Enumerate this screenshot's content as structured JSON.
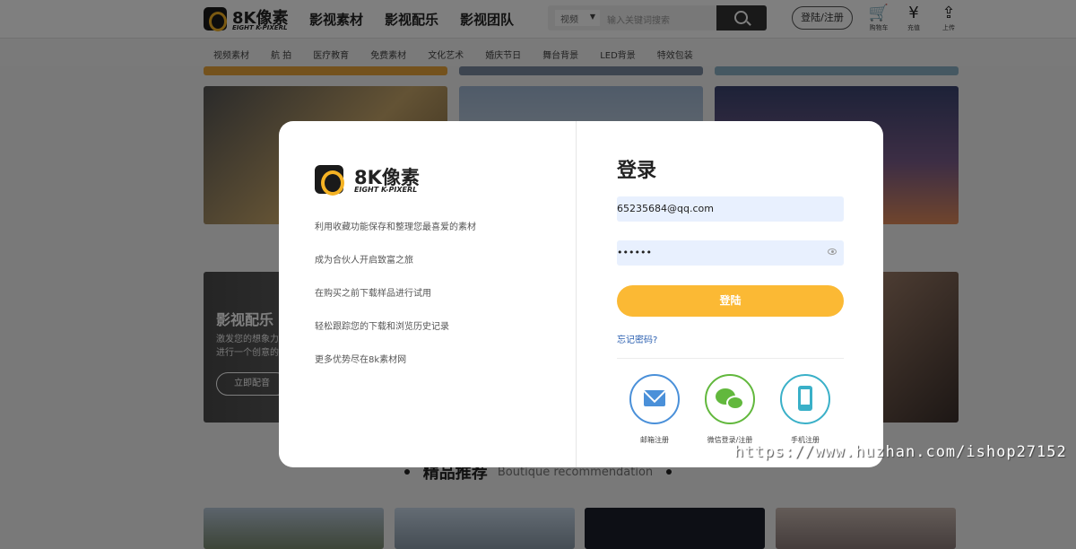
{
  "header": {
    "logo_title": "8K像素",
    "logo_sub": "EIGHT K-PIXERL",
    "nav": [
      "影视素材",
      "影视配乐",
      "影视团队"
    ],
    "search_select": "视频",
    "search_placeholder": "输入关键词搜索",
    "login_label": "登陆/注册",
    "icons": [
      {
        "name": "cart-icon",
        "glyph": "🛒",
        "label": "购物车"
      },
      {
        "name": "yen-icon",
        "glyph": "¥",
        "label": "充值"
      },
      {
        "name": "upload-icon",
        "glyph": "⇪",
        "label": "上传"
      }
    ]
  },
  "subnav": [
    "视频素材",
    "航 拍",
    "医疗教育",
    "免费素材",
    "文化艺术",
    "婚庆节日",
    "舞台背景",
    "LED背景",
    "特效包装"
  ],
  "banner": {
    "title": "影视配乐",
    "subtitle_1": "激发您的想象力",
    "subtitle_2": "进行一个创意的",
    "button": "立即配音"
  },
  "recommend": {
    "title": "精品推荐",
    "subtitle": "Boutique recommendation"
  },
  "modal": {
    "logo_title": "8K像素",
    "logo_sub": "EIGHT K-PIXERL",
    "features": [
      "利用收藏功能保存和整理您最喜爱的素材",
      "成为合伙人开启致富之旅",
      "在购买之前下载样品进行试用",
      "轻松跟踪您的下载和浏览历史记录",
      "更多优势尽在8k素材网"
    ],
    "title": "登录",
    "email_value": "65235684@qq.com",
    "password_value": "••••••",
    "submit_label": "登陆",
    "forgot_label": "忘记密码?",
    "social": [
      {
        "name": "email-register",
        "label": "邮箱注册"
      },
      {
        "name": "wechat-login",
        "label": "微信登录/注册"
      },
      {
        "name": "phone-register",
        "label": "手机注册"
      }
    ]
  },
  "watermark": "https://www.huzhan.com/ishop27152",
  "colors": {
    "accent": "#fbb934",
    "brand_dark": "#1a1a1a",
    "link": "#2a5fb0"
  }
}
